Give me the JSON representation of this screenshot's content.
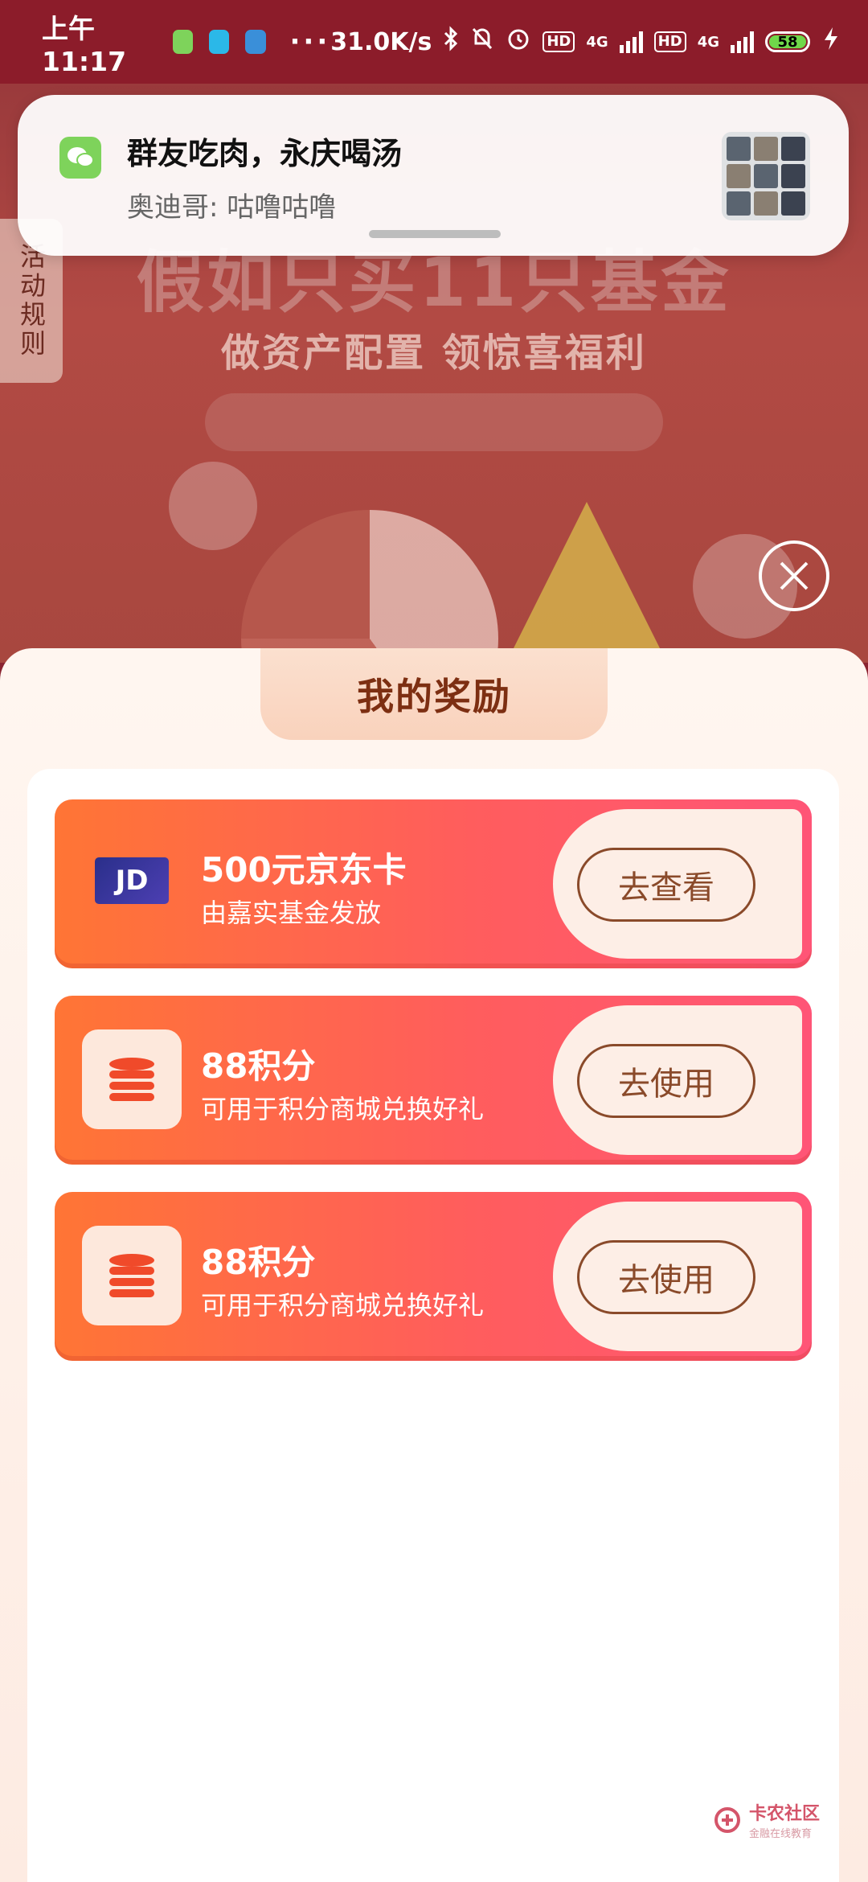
{
  "status_bar": {
    "time": "上午11:17",
    "more": "···",
    "net_speed": "31.0K/s",
    "hd": "HD",
    "network_type": "4G",
    "battery": "58"
  },
  "notification": {
    "title": "群友吃肉，永庆喝汤",
    "body": "奥迪哥: 咕噜咕噜",
    "app_icon": "wechat-icon"
  },
  "banner": {
    "headline": "假如只买11只基金",
    "subtitle": "做资产配置 领惊喜福利",
    "rules_tab": "活动规则"
  },
  "sheet": {
    "title": "我的奖励",
    "rewards": [
      {
        "title": "500元京东卡",
        "desc": "由嘉实基金发放",
        "button": "去查看",
        "icon": "jd-card-icon",
        "card_text": "JD"
      },
      {
        "title": "88积分",
        "desc": "可用于积分商城兑换好礼",
        "button": "去使用",
        "icon": "coins-stack-icon"
      },
      {
        "title": "88积分",
        "desc": "可用于积分商城兑换好礼",
        "button": "去使用",
        "icon": "coins-stack-icon"
      }
    ]
  },
  "watermark": {
    "name": "卡农社区",
    "sub": "金融在线教育"
  },
  "colors": {
    "status_bg": "#8c1c2a",
    "reward_gradient_start": "#ff7535",
    "reward_gradient_end": "#ff5577",
    "button_text": "#8a4a2a",
    "sheet_title": "#7d2f12"
  }
}
